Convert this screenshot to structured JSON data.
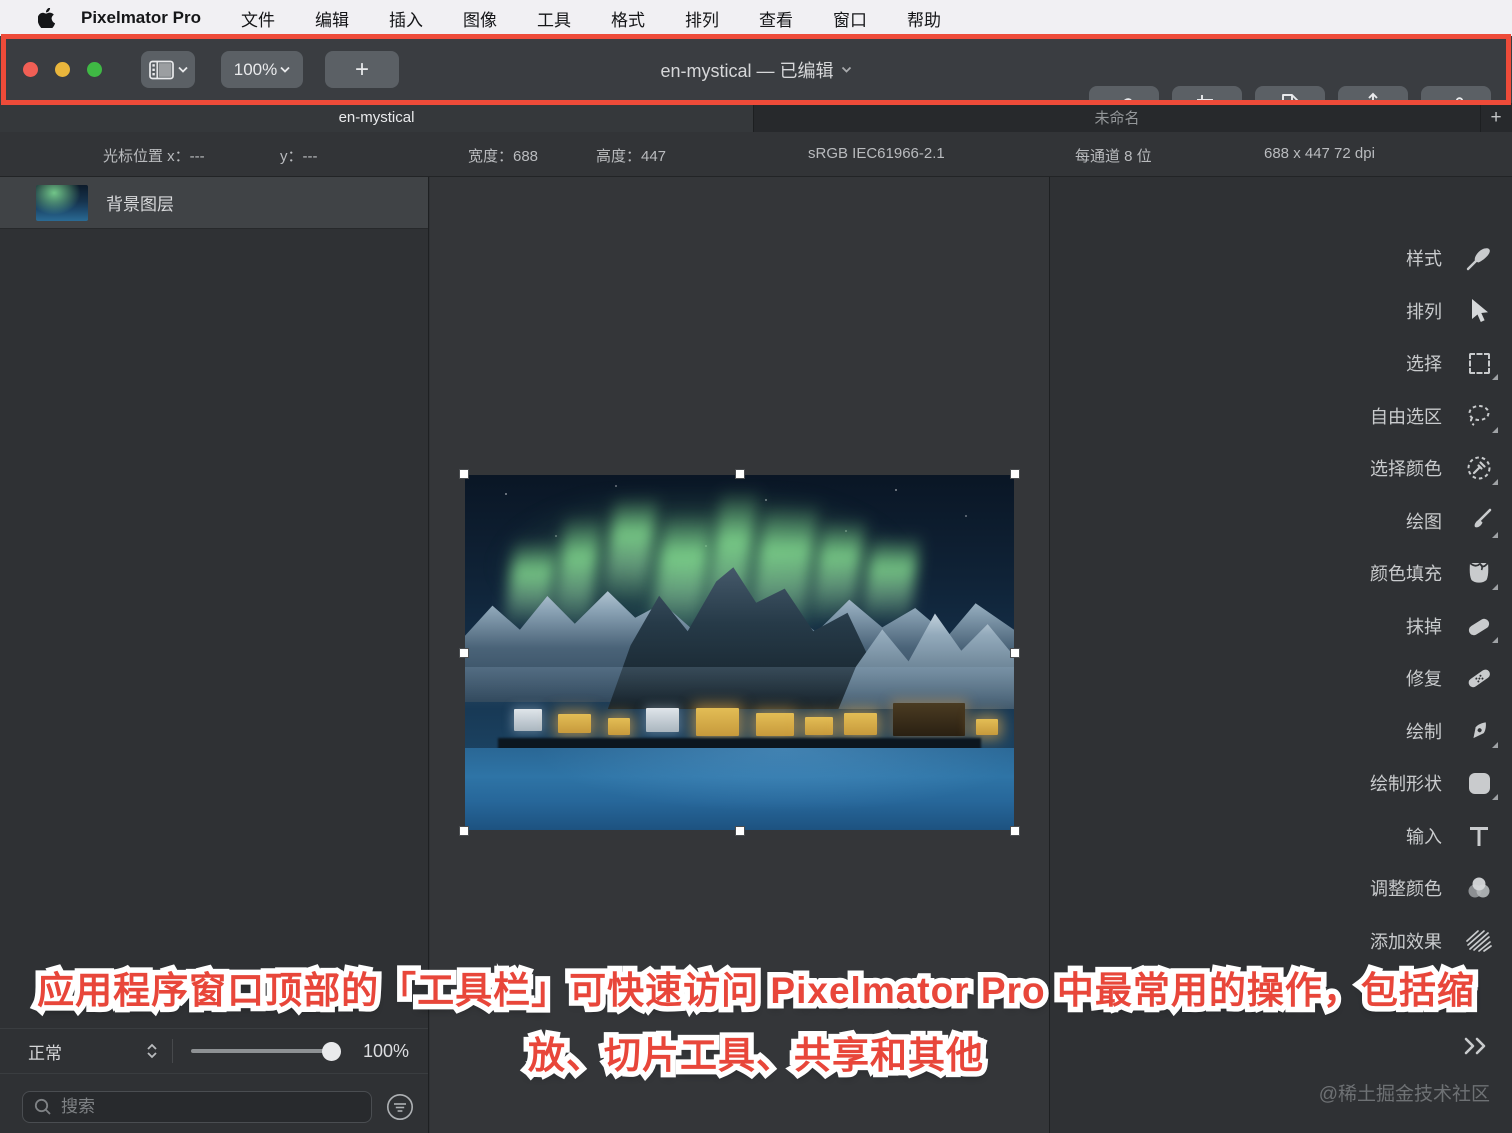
{
  "menu_bar": {
    "app_name": "Pixelmator Pro",
    "items": [
      "文件",
      "编辑",
      "插入",
      "图像",
      "工具",
      "格式",
      "排列",
      "查看",
      "窗口",
      "帮助"
    ]
  },
  "toolbar": {
    "zoom_value": "100%",
    "add_label": "+",
    "title": "en-mystical — 已编辑",
    "button_icons": [
      "view-options",
      "zoom-menu",
      "add-new",
      "retouch-pen",
      "crop",
      "slice",
      "share",
      "settings-sliders"
    ]
  },
  "tabs": {
    "active_tab": "en-mystical",
    "inactive_tab": "未命名",
    "add_tab_label": "+"
  },
  "info_bar": {
    "cursor_x": "光标位置 x：---",
    "cursor_y": "y：---",
    "width": "宽度：688",
    "height": "高度：447",
    "color_profile": "sRGB IEC61966-2.1",
    "bit_depth": "每通道 8 位",
    "dimensions": "688 x 447 72 dpi"
  },
  "layers": {
    "selected_layer": "背景图层"
  },
  "bottom_left": {
    "blend_mode": "正常",
    "opacity": "100%",
    "search_placeholder": "搜索"
  },
  "tools": [
    {
      "label": "样式",
      "icon": "style-brush"
    },
    {
      "label": "排列",
      "icon": "arrange-cursor"
    },
    {
      "label": "选择",
      "icon": "select-marquee"
    },
    {
      "label": "自由选区",
      "icon": "free-select-lasso"
    },
    {
      "label": "选择颜色",
      "icon": "select-color-eyedropper"
    },
    {
      "label": "绘图",
      "icon": "paint-brush"
    },
    {
      "label": "颜色填充",
      "icon": "color-fill-bucket"
    },
    {
      "label": "抹掉",
      "icon": "eraser"
    },
    {
      "label": "修复",
      "icon": "repair-bandaid"
    },
    {
      "label": "绘制",
      "icon": "pen-nib"
    },
    {
      "label": "绘制形状",
      "icon": "draw-shape"
    },
    {
      "label": "输入",
      "icon": "type-text"
    },
    {
      "label": "调整颜色",
      "icon": "adjust-colors"
    },
    {
      "label": "添加效果",
      "icon": "add-effects"
    }
  ],
  "annotation": {
    "line1": "应用程序窗口顶部的「工具栏」可快速访问 Pixelmator Pro 中最常用的操作，包括缩",
    "line2": "放、切片工具、共享和其他",
    "color": "#e8463a"
  },
  "watermark": "@稀土掘金技术社区",
  "colors": {
    "highlight_border": "#ee4b39",
    "toolbar_bg": "#3a3d41",
    "panel_bg": "#2f3134",
    "aurora_green": "#8ceb96",
    "menu_bar_bg": "#f1f0f3"
  }
}
